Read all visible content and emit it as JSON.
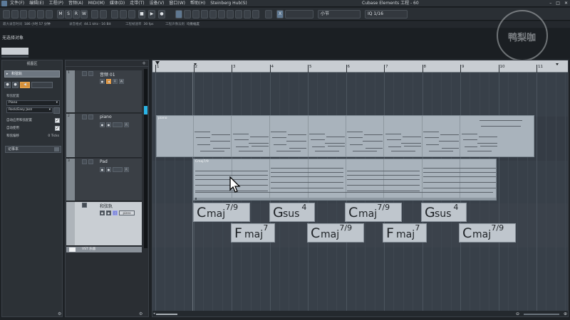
{
  "window_title": "Cubase Elements 工程 - 60",
  "menu": [
    "文件(F)",
    "编辑(E)",
    "工程(P)",
    "音频(A)",
    "MIDI(M)",
    "媒体(D)",
    "走带(T)",
    "设备(V)",
    "窗口(W)",
    "帮助(H)",
    "Steinberg Hub(S)"
  ],
  "window_controls": [
    "–",
    "□",
    "✕"
  ],
  "toolbar": {
    "mode_buttons": [
      "M",
      "S",
      "R",
      "W"
    ],
    "snap_type": "小节",
    "quantize": "1/16",
    "quantize_prefix": "IQ",
    "snap_icon": "X"
  },
  "infoline": [
    {
      "label": "最大录音时间",
      "value": "186 小时 57 分钟"
    },
    {
      "label": "录音格式",
      "value": "44.1 kHz - 16 Bit"
    },
    {
      "label": "工程帧速率",
      "value": "30 fps"
    },
    {
      "label": "工程声像法则",
      "value": "均衡幅度"
    }
  ],
  "no_object_text": "无选择对象",
  "inspector": {
    "title": "视图区",
    "track_button": "和弦轨",
    "fields": [
      {
        "label": "和弦配置",
        "value": "Piano"
      },
      {
        "label": "",
        "value": "Rock/Easy Jazz"
      }
    ],
    "checks": [
      {
        "label": "自动应用和弦配置",
        "checked": true
      },
      {
        "label": "自动使用",
        "checked": true
      },
      {
        "label": "和弦偏移",
        "value": "0 Ticks"
      }
    ],
    "notebook": "记事本"
  },
  "tracks": [
    {
      "num": "1",
      "name": "音频 01"
    },
    {
      "num": "2",
      "name": "piano"
    },
    {
      "num": "3",
      "name": "Pad"
    },
    {
      "num": "",
      "name": "和弦轨",
      "link": "piano"
    }
  ],
  "vst_label": "VST 乐器",
  "ruler": {
    "bars": [
      "1",
      "2",
      "3",
      "4",
      "5",
      "6",
      "7",
      "8",
      "9",
      "10",
      "11"
    ]
  },
  "parts": [
    {
      "label": "piano"
    },
    {
      "label": "Cmaj7/9"
    }
  ],
  "chord_events": [
    {
      "root": "C",
      "quality": "maj",
      "ext": "7/9"
    },
    {
      "root": "G",
      "quality": "sus",
      "ext": "4"
    },
    {
      "root": "C",
      "quality": "maj",
      "ext": "7/9"
    },
    {
      "root": "G",
      "quality": "sus",
      "ext": "4"
    },
    {
      "root": "F",
      "quality": "maj",
      "ext": "7"
    },
    {
      "root": "C",
      "quality": "maj",
      "ext": "7/9"
    },
    {
      "root": "F",
      "quality": "maj",
      "ext": "7"
    },
    {
      "root": "C",
      "quality": "maj",
      "ext": "7/9"
    }
  ],
  "watermark_text": "鸭梨咖",
  "colors": {
    "accent": "#d6913a",
    "meter": "#2ab4e6",
    "part": "#a9b3bc"
  }
}
